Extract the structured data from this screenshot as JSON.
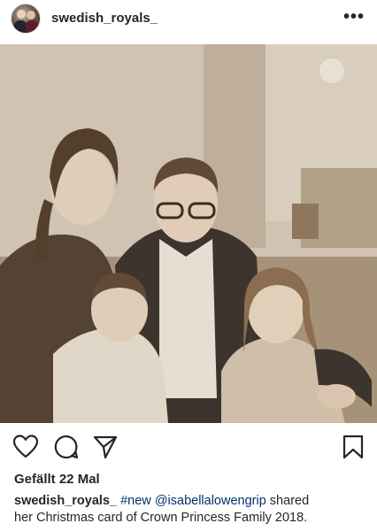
{
  "post": {
    "username": "swedish_royals_",
    "more_label": "•••"
  },
  "actions": {
    "like_icon": "heart-icon",
    "comment_icon": "comment-icon",
    "share_icon": "paper-plane-icon",
    "save_icon": "bookmark-icon"
  },
  "likes": {
    "text": "Gefällt 22 Mal"
  },
  "caption": {
    "username": "swedish_royals_",
    "hashtag": "#new",
    "mention": "@isabellalowengrip",
    "text_line1_tail": " shared",
    "text_line2": "her Christmas card of Crown Princess Family 2018."
  },
  "colors": {
    "text": "#262626",
    "link": "#003569",
    "background": "#ffffff"
  }
}
